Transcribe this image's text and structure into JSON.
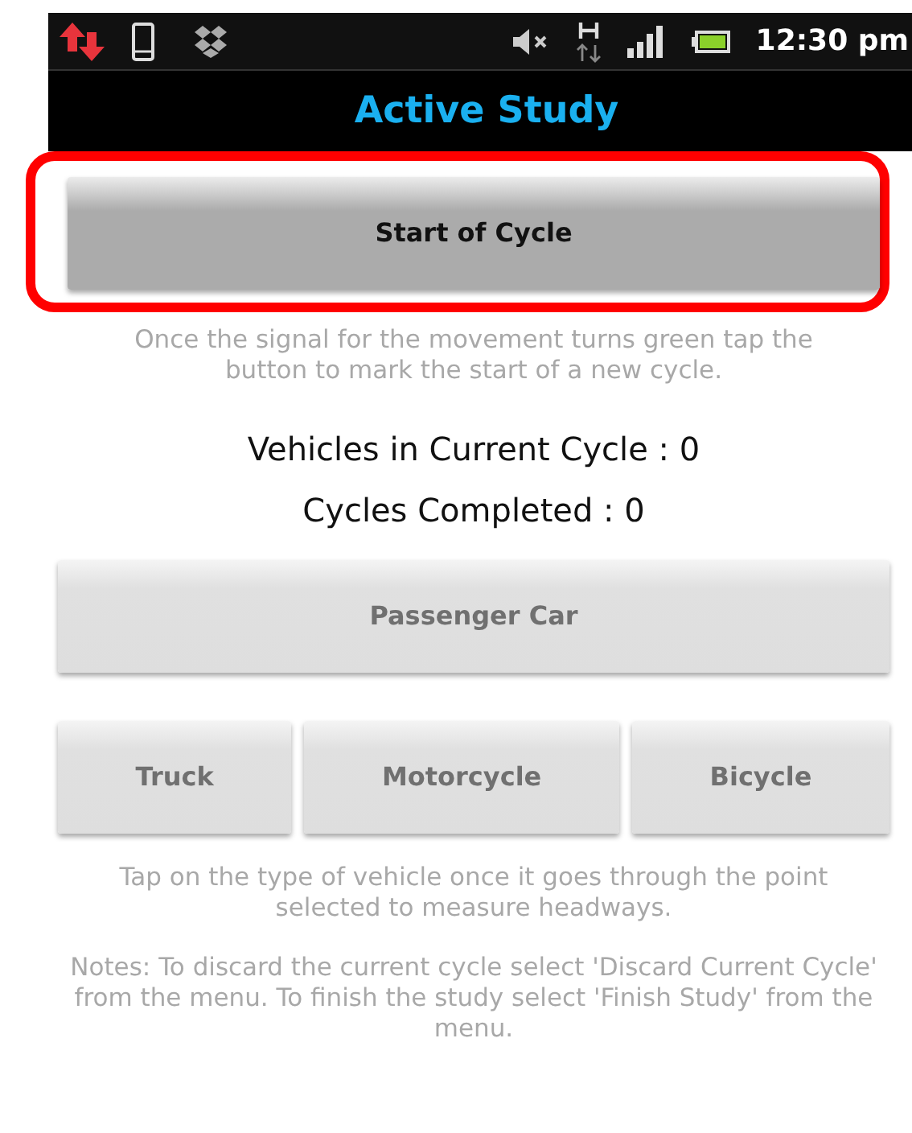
{
  "status_bar": {
    "time": "12:30 pm"
  },
  "title": "Active Study",
  "start_button": {
    "label": "Start of Cycle",
    "disabled": false,
    "highlighted": true
  },
  "start_hint": "Once the signal for the movement turns green tap the button to mark the start of a new cycle.",
  "counters": [
    "Vehicles in Current Cycle : 0",
    "Cycles Completed : 0"
  ],
  "passenger_button": {
    "label": "Passenger Car",
    "disabled": true
  },
  "vehicle_buttons": [
    {
      "label": "Truck",
      "disabled": true
    },
    {
      "label": "Motorcycle",
      "disabled": true
    },
    {
      "label": "Bicycle",
      "disabled": true
    }
  ],
  "vehicle_hint": "Tap on the type of vehicle once it goes through the point selected to measure headways.",
  "notes": "Notes: To discard the current cycle select 'Discard Current Cycle' from the menu. To finish the study select 'Finish Study' from the menu."
}
